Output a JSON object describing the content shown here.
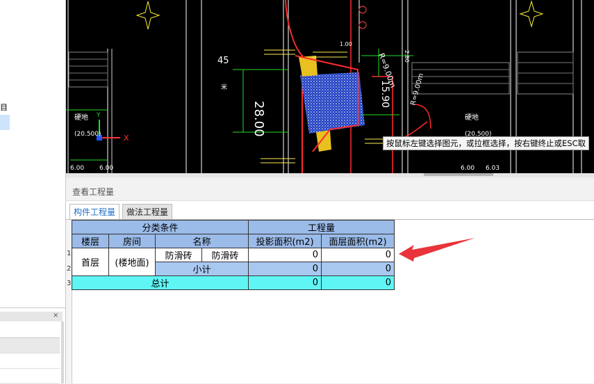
{
  "left_panel": {
    "partial_label": "目",
    "close_glyph": "×"
  },
  "cad": {
    "tooltip": "按鼠标左键选择图元，或拉框选择，按右键终止或ESC取",
    "labels": {
      "num_45": "45",
      "dim_28": "28.00",
      "dim_1590": "15.90",
      "r_900": "R=9.00m",
      "r_9": "R=9.00m",
      "hard_left": "硬地",
      "hard_right": "硬地",
      "elev_left": "(20.500)",
      "elev_right": "(20.500)",
      "dim_600a": "6.00",
      "dim_600b": "6.00",
      "dim_600c": "6.03",
      "dim_600d": "6.00",
      "dim_100": "1.00",
      "dim_280": "2.80",
      "dim_mi": "米",
      "axis_x": "X",
      "axis_y": "Y"
    }
  },
  "qty_panel": {
    "title": "查看工程量",
    "tabs": [
      "构件工程量",
      "做法工程量"
    ]
  },
  "table": {
    "group_classify": "分类条件",
    "group_qty": "工程量",
    "col_floor": "楼层",
    "col_room": "房间",
    "col_name": "名称",
    "col_proj_area": "投影面积(m2)",
    "col_layer_area": "面层面积(m2)",
    "row_numbers": [
      "1",
      "2",
      "3"
    ],
    "floor": "首层",
    "room": "(楼地面)",
    "name1": "防滑砖",
    "name2": "防滑砖",
    "r1_proj": "0",
    "r1_layer": "0",
    "subtotal_label": "小计",
    "r2_proj": "0",
    "r2_layer": "0",
    "total_label": "总计",
    "r3_proj": "0",
    "r3_layer": "0"
  },
  "colors": {
    "header": "#9bbbe9",
    "subtotal": "#a8c8f0",
    "total": "#5ff5f5",
    "arrow": "#e8343a",
    "tab_active_text": "#1f6fc4"
  }
}
